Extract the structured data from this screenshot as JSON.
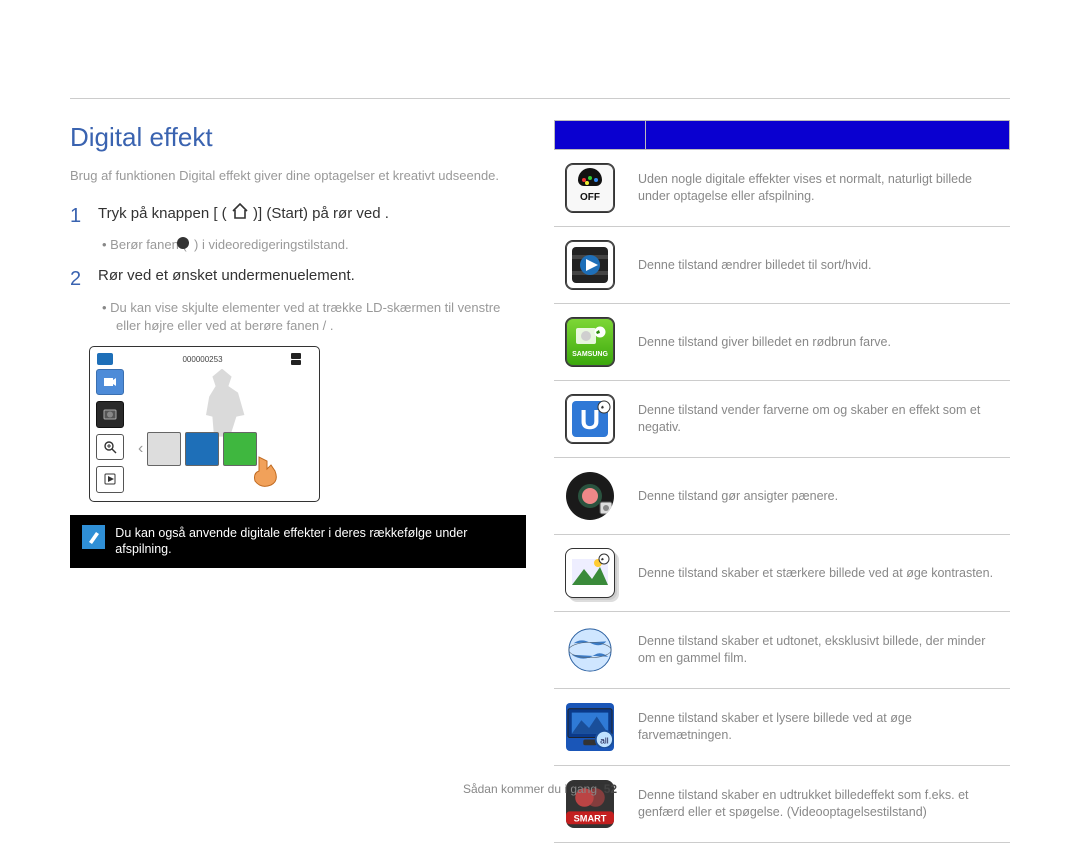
{
  "title": "Digital effekt",
  "intro": "Brug af funktionen Digital effekt giver dine optagelser et kreativt udseende.",
  "steps": {
    "one": {
      "num": "1",
      "text_pre": "Tryk på knappen [ (",
      "text_post": ")] (Start) på rør ved ."
    },
    "one_bullet": {
      "pre": "Berør fanen  (",
      "post": " ) i videoredigeringstilstand."
    },
    "two": {
      "num": "2",
      "text": "Rør ved et ønsket undermenuelement."
    },
    "two_bullet": "Du kan vise skjulte elementer ved at trække LD-skærmen til venstre eller højre eller ved at berøre fanen          /          ."
  },
  "lcd_counter": "000000253",
  "note": "Du kan også anvende digitale effekter i deres rækkefølge under afspilning.",
  "modes": [
    {
      "name": "off",
      "desc": "Uden nogle digitale effekter vises et normalt, naturligt billede under optagelse eller afspilning."
    },
    {
      "name": "bw",
      "desc": "Denne tilstand ændrer billedet til sort/hvid."
    },
    {
      "name": "sepia",
      "desc": "Denne tilstand giver billedet en rødbrun farve."
    },
    {
      "name": "neg",
      "desc": "Denne tilstand vender farverne om og skaber en effekt som et negativ."
    },
    {
      "name": "face",
      "desc": "Denne tilstand gør ansigter pænere."
    },
    {
      "name": "cont",
      "desc": "Denne tilstand skaber et stærkere billede ved at øge kontrasten."
    },
    {
      "name": "old",
      "desc": "Denne tilstand skaber et udtonet, eksklusivt billede, der minder om en gammel film."
    },
    {
      "name": "sat",
      "desc": "Denne tilstand skaber et lysere billede ved at øge farvemætningen."
    },
    {
      "name": "ghost",
      "desc": "Denne tilstand skaber en udtrukket billedeffekt som f.eks. et genfærd eller et spøgelse. (Videooptagelsestilstand)"
    }
  ],
  "footer": {
    "section": "Sådan kommer du i gang",
    "page": "52"
  },
  "smart_label": "SMART",
  "neg_letter": "U",
  "off_label": "OFF"
}
